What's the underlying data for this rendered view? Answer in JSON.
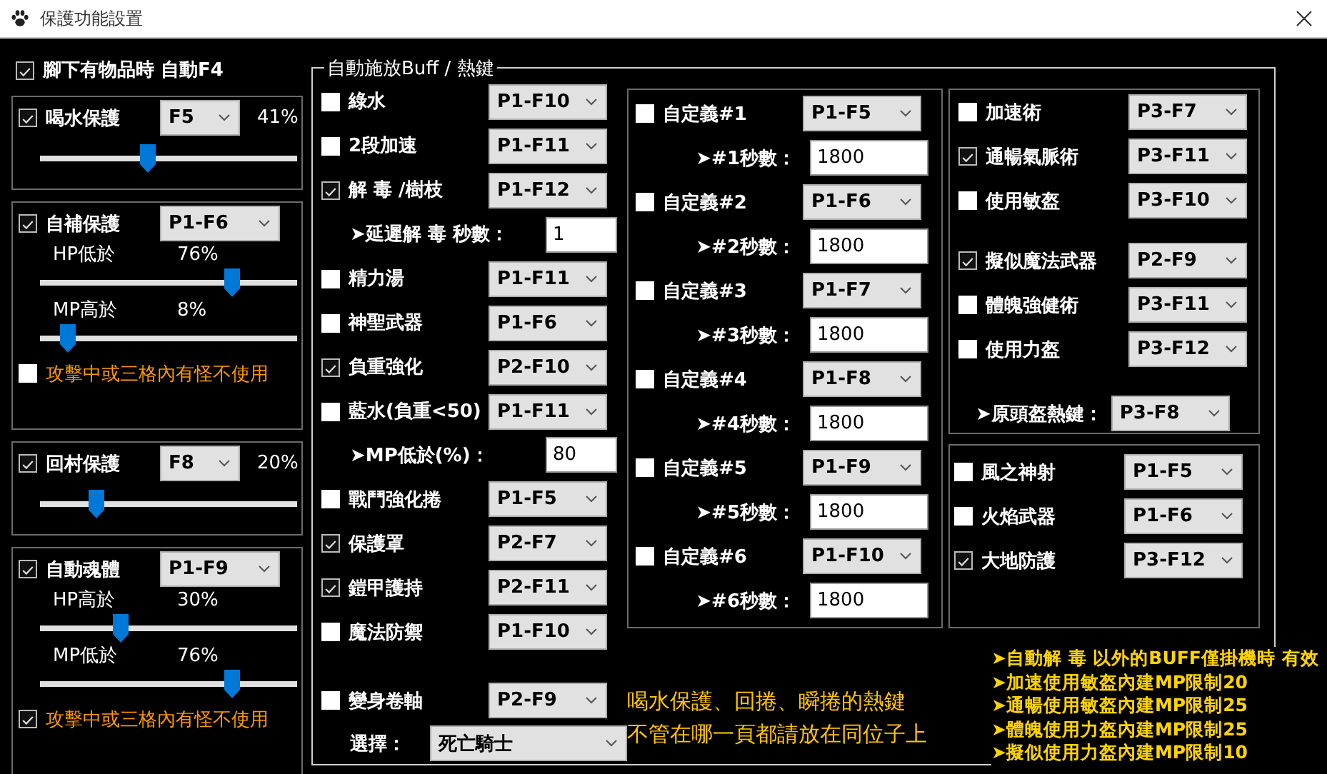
{
  "window": {
    "title": "保護功能設置"
  },
  "auto_pickup": {
    "label": "腳下有物品時 自動F4",
    "checked": true
  },
  "protections": [
    {
      "kind": "inline",
      "label": "喝水保護",
      "checked": true,
      "hotkey": "F5",
      "reading": "41%",
      "level": 0.41
    },
    {
      "kind": "stacked",
      "label": "自補保護",
      "checked": true,
      "hotkey": "P1-F6",
      "sliders": [
        {
          "label": "HP低於",
          "reading": "76%",
          "level": 0.76
        },
        {
          "label": "MP高於",
          "reading": "8%",
          "level": 0.08
        }
      ],
      "avoid": {
        "label": "攻擊中或三格內有怪不使用",
        "checked": false
      }
    },
    {
      "kind": "inline",
      "label": "回村保護",
      "checked": true,
      "hotkey": "F8",
      "reading": "20%",
      "level": 0.2
    },
    {
      "kind": "stacked",
      "label": "自動魂體",
      "checked": true,
      "hotkey": "P1-F9",
      "sliders": [
        {
          "label": "HP高於",
          "reading": "30%",
          "level": 0.3
        },
        {
          "label": "MP低於",
          "reading": "76%",
          "level": 0.76
        }
      ],
      "avoid": {
        "label": "攻擊中或三格內有怪不使用",
        "checked": true
      }
    }
  ],
  "buff": {
    "title": "自動施放Buff / 熱鍵",
    "skills": [
      {
        "kind": "hotkey",
        "label": "綠水",
        "checked": false,
        "hotkey": "P1-F10"
      },
      {
        "kind": "hotkey",
        "label": "2段加速",
        "checked": false,
        "hotkey": "P1-F11"
      },
      {
        "kind": "hotkey",
        "label": "解 毒 /樹枝",
        "checked": true,
        "hotkey": "P1-F12"
      },
      {
        "kind": "number",
        "label": "➤延遲解 毒 秒數：",
        "value": "1"
      },
      {
        "kind": "hotkey",
        "label": "精力湯",
        "checked": false,
        "hotkey": "P1-F11"
      },
      {
        "kind": "hotkey",
        "label": "神聖武器",
        "checked": false,
        "hotkey": "P1-F6"
      },
      {
        "kind": "hotkey",
        "label": "負重強化",
        "checked": true,
        "hotkey": "P2-F10"
      },
      {
        "kind": "hotkey",
        "label": "藍水(負重<50)",
        "checked": false,
        "hotkey": "P1-F11"
      },
      {
        "kind": "number",
        "label": "➤MP低於(%)：",
        "value": "80"
      },
      {
        "kind": "hotkey",
        "label": "戰鬥強化捲",
        "checked": false,
        "hotkey": "P1-F5"
      },
      {
        "kind": "hotkey",
        "label": "保護罩",
        "checked": true,
        "hotkey": "P2-F7"
      },
      {
        "kind": "hotkey",
        "label": "鎧甲護持",
        "checked": true,
        "hotkey": "P2-F11"
      },
      {
        "kind": "hotkey",
        "label": "魔法防禦",
        "checked": false,
        "hotkey": "P1-F10"
      }
    ],
    "transform": {
      "label": "變身卷軸",
      "checked": false,
      "hotkey": "P2-F9",
      "choice_label": "選擇：",
      "choice": "死亡騎士"
    },
    "custom": [
      {
        "label": "自定義#1",
        "checked": false,
        "hotkey": "P1-F5",
        "seconds_label": "➤#1秒數：",
        "seconds": "1800"
      },
      {
        "label": "自定義#2",
        "checked": false,
        "hotkey": "P1-F6",
        "seconds_label": "➤#2秒數：",
        "seconds": "1800"
      },
      {
        "label": "自定義#3",
        "checked": false,
        "hotkey": "P1-F7",
        "seconds_label": "➤#3秒數：",
        "seconds": "1800"
      },
      {
        "label": "自定義#4",
        "checked": false,
        "hotkey": "P1-F8",
        "seconds_label": "➤#4秒數：",
        "seconds": "1800"
      },
      {
        "label": "自定義#5",
        "checked": false,
        "hotkey": "P1-F9",
        "seconds_label": "➤#5秒數：",
        "seconds": "1800"
      },
      {
        "label": "自定義#6",
        "checked": false,
        "hotkey": "P1-F10",
        "seconds_label": "➤#6秒數：",
        "seconds": "1800"
      }
    ],
    "spells": [
      [
        {
          "label": "加速術",
          "checked": false,
          "hotkey": "P3-F7"
        },
        {
          "label": "通暢氣脈術",
          "checked": true,
          "hotkey": "P3-F11"
        },
        {
          "label": "使用敏盔",
          "checked": false,
          "hotkey": "P3-F10"
        }
      ],
      [
        {
          "label": "擬似魔法武器",
          "checked": true,
          "hotkey": "P2-F9"
        },
        {
          "label": "體魄強健術",
          "checked": false,
          "hotkey": "P3-F11"
        },
        {
          "label": "使用力盔",
          "checked": false,
          "hotkey": "P3-F12"
        }
      ]
    ],
    "helm": {
      "label": "➤原頭盔熱鍵：",
      "hotkey": "P3-F8"
    },
    "elemental": [
      {
        "label": "風之神射",
        "checked": false,
        "hotkey": "P1-F5"
      },
      {
        "label": "火焰武器",
        "checked": false,
        "hotkey": "P1-F6"
      },
      {
        "label": "大地防護",
        "checked": true,
        "hotkey": "P3-F12"
      }
    ],
    "hint": [
      "喝水保護、回捲、瞬捲的熱鍵",
      "不管在哪一頁都請放在同位子上"
    ],
    "notes": [
      "➤自動解 毒 以外的BUFF僅掛機時 有效",
      "➤加速使用敏盔內建MP限制20",
      "➤通暢使用敏盔內建MP限制25",
      "➤體魄使用力盔內建MP限制25",
      "➤擬似使用力盔內建MP限制10"
    ]
  }
}
